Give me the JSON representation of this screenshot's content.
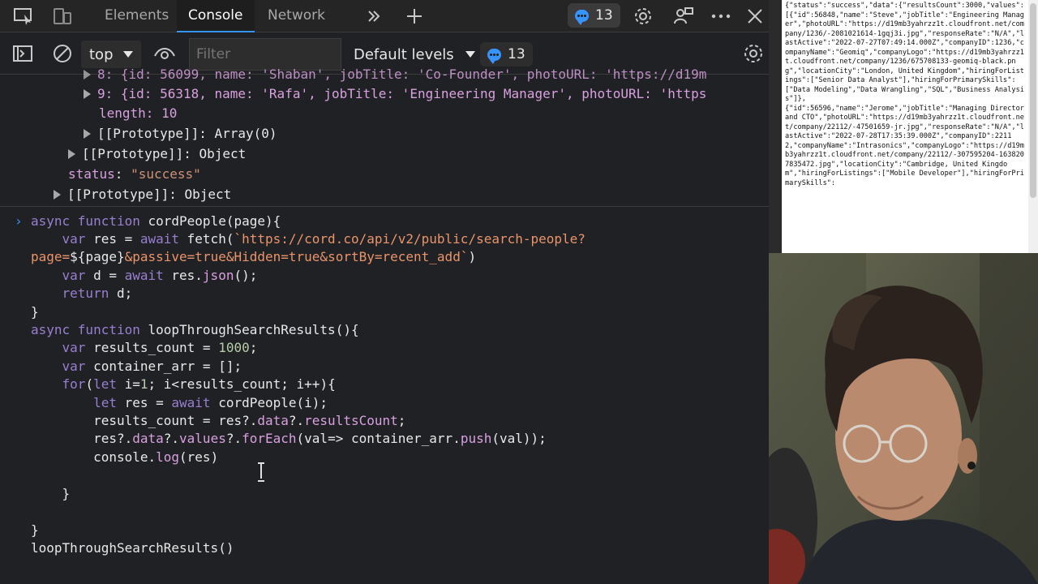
{
  "tabs": [
    "Elements",
    "Console",
    "Network"
  ],
  "active_tab": "Console",
  "issues_count": "13",
  "toolbar": {
    "context": "top",
    "filter_placeholder": "Filter",
    "levels": "Default levels",
    "messages_count": "13"
  },
  "console": {
    "object_lines": [
      "9: {id: 56318, name: 'Rafa', jobTitle: 'Engineering Manager', photoURL: 'https",
      "length: 10",
      "[[Prototype]]: Array(0)",
      "[[Prototype]]: Object",
      "[[Prototype]]: Object"
    ],
    "status_key": "status",
    "status_value": "\"success\"",
    "partial_line": "8: {id: 56099, name: 'Shaban', jobTitle: 'Co-Founder', photoURL: 'https://d19m"
  },
  "json_panel_text": "{\"status\":\"success\",\"data\":{\"resultsCount\":3000,\"values\":[{\"id\":56848,\"name\":\"Steve\",\"jobTitle\":\"Engineering Manager\",\"photoURL\":\"https://d19mb3yahrzz1t.cloudfront.net/company/1236/-2081021614-1gqj3i.jpg\",\"responseRate\":\"N/A\",\"lastActive\":\"2022-07-27T07:49:14.000Z\",\"companyID\":1236,\"companyName\":\"Geomiq\",\"companyLogo\":\"https://d19mb3yahrzz1t.cloudfront.net/company/1236/675708133-geomiq-black.png\",\"locationCity\":\"London, United Kingdom\",\"hiringForListings\":[\"Senior Data Analyst\"],\"hiringForPrimarySkills\":[\"Data Modeling\",\"Data Wrangling\",\"SQL\",\"Business Analysis\"]},\n{\"id\":56596,\"name\":\"Jerome\",\"jobTitle\":\"Managing Director and CTO\",\"photoURL\":\"https://d19mb3yahrzz1t.cloudfront.net/company/22112/-47501659-jr.jpg\",\"responseRate\":\"N/A\",\"lastActive\":\"2022-07-28T17:35:39.000Z\",\"companyID\":22112,\"companyName\":\"Intrasonics\",\"companyLogo\":\"https://d19mb3yahrzz1t.cloudfront.net/company/22112/-307595204-1638207835472.jpg\",\"locationCity\":\"Cambridge, United Kingdom\",\"hiringForListings\":[\"Mobile Developer\"],\"hiringForPrimarySkills\":"
}
